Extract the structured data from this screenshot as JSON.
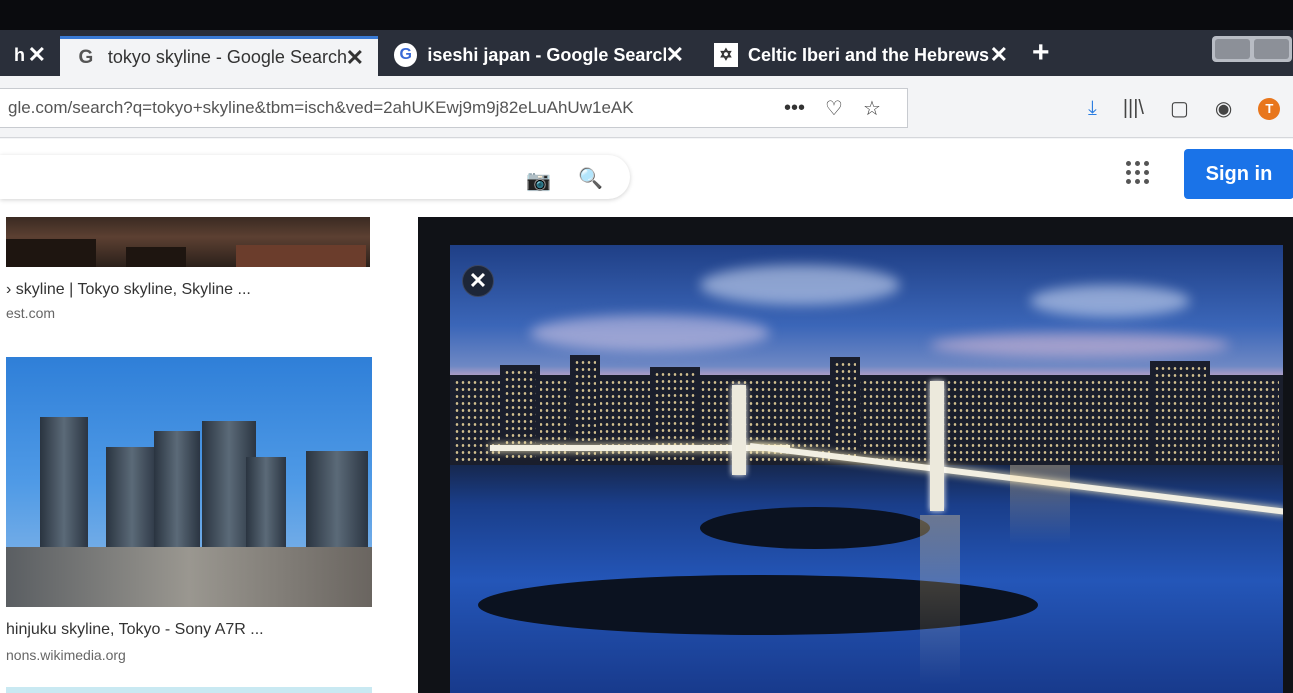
{
  "tabs": [
    {
      "title": "h",
      "close": "✕"
    },
    {
      "title": "tokyo skyline - Google Search",
      "close": "✕",
      "favicon": "G",
      "active": true
    },
    {
      "title": "iseshi japan - Google Search",
      "close": "✕",
      "favicon": "G"
    },
    {
      "title": "Celtic Iberi and the Hebrews",
      "close": "✕",
      "favicon": "✡"
    }
  ],
  "newtab_label": "+",
  "url": "gle.com/search?q=tokyo+skyline&tbm=isch&ved=2ahUKEwj9m9j82eLuAhUw1eAK",
  "url_icons": {
    "more": "•••",
    "pocket": "♡",
    "bookmark": "☆"
  },
  "toolbar_icons": {
    "download": "⤓",
    "library": "|||\\",
    "sidebar": "▢",
    "account": "◉",
    "profile": "T"
  },
  "header": {
    "camera_icon": "📷",
    "search_icon": "🔍",
    "signin_label": "Sign in"
  },
  "results": [
    {
      "title": "› skyline | Tokyo skyline, Skyline ...",
      "source": "est.com"
    },
    {
      "title": "hinjuku skyline, Tokyo - Sony A7R ...",
      "source": "nons.wikimedia.org"
    }
  ],
  "preview": {
    "close": "✕"
  }
}
